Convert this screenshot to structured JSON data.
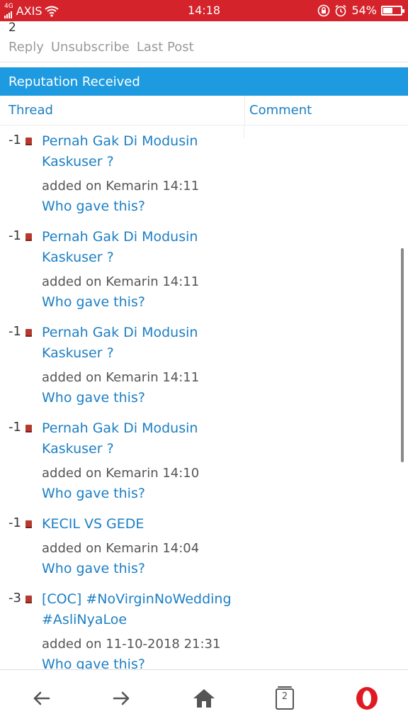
{
  "status_bar": {
    "network_type": "4G",
    "carrier": "AXIS",
    "time": "14:18",
    "battery_percent": "54%",
    "battery_level": 0.54
  },
  "top": {
    "count": "2",
    "actions": [
      "Reply",
      "Unsubscribe",
      "Last Post"
    ]
  },
  "section": {
    "title": "Reputation Received",
    "col_thread": "Thread",
    "col_comment": "Comment"
  },
  "items": [
    {
      "score": "-1",
      "title": "Pernah Gak Di Modusin Kaskuser ?",
      "added": "added on Kemarin 14:11",
      "who": "Who gave this?"
    },
    {
      "score": "-1",
      "title": "Pernah Gak Di Modusin Kaskuser ?",
      "added": "added on Kemarin 14:11",
      "who": "Who gave this?"
    },
    {
      "score": "-1",
      "title": "Pernah Gak Di Modusin Kaskuser ?",
      "added": "added on Kemarin 14:11",
      "who": "Who gave this?"
    },
    {
      "score": "-1",
      "title": "Pernah Gak Di Modusin Kaskuser ?",
      "added": "added on Kemarin 14:10",
      "who": "Who gave this?"
    },
    {
      "score": "-1",
      "title": "KECIL VS GEDE",
      "added": "added on Kemarin 14:04",
      "who": "Who gave this?"
    },
    {
      "score": "-3",
      "title": "[COC] #NoVirginNoWedding #AsliNyaLoe",
      "added": "added on 11-10-2018 21:31",
      "who": "Who gave this?"
    }
  ],
  "bottom_nav": {
    "icons": [
      "back-arrow-icon",
      "forward-arrow-icon",
      "home-icon",
      "tabs-icon",
      "opera-logo-icon"
    ],
    "tab_count": "2"
  },
  "colors": {
    "status_bar": "#d5232b",
    "section_header": "#1e9be0",
    "link": "#1c7fc4",
    "opera_red": "#e01a22"
  }
}
